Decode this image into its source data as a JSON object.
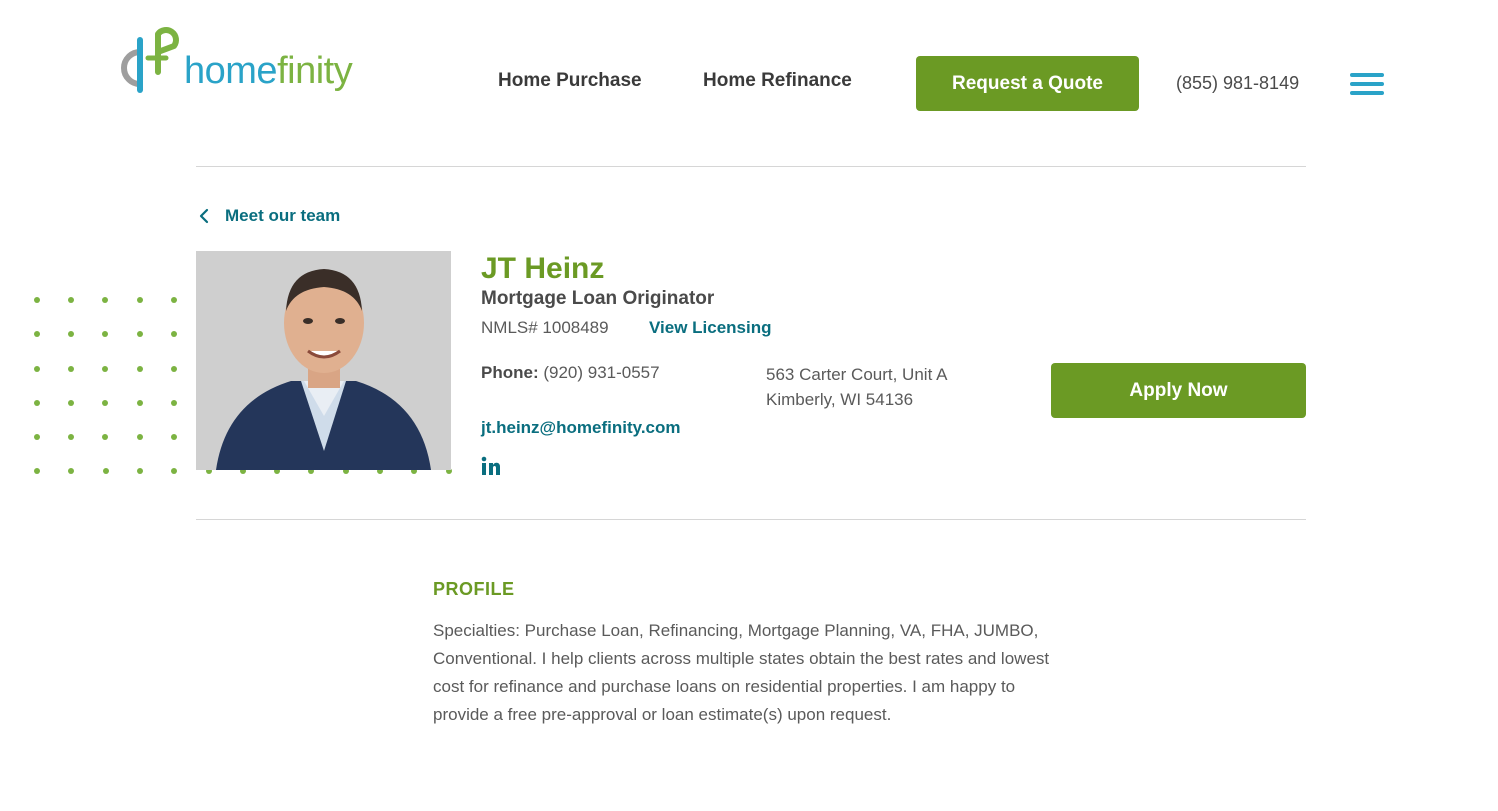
{
  "header": {
    "logo_home": "home",
    "logo_finity": "finity",
    "nav": [
      {
        "label": "Home Purchase"
      },
      {
        "label": "Home Refinance"
      }
    ],
    "cta_label": "Request a Quote",
    "phone": "(855) 981-8149",
    "menu_icon": "hamburger-icon"
  },
  "breadcrumb": {
    "icon": "chevron-left-icon",
    "label": "Meet our team"
  },
  "profile": {
    "name": "JT Heinz",
    "title": "Mortgage Loan Originator",
    "nmls": "NMLS# 1008489",
    "licensing_label": "View Licensing",
    "phone_label": "Phone:",
    "phone": "(920) 931-0557",
    "email": "jt.heinz@homefinity.com",
    "social_icon": "linkedin-icon",
    "address_line1": "563 Carter Court, Unit A",
    "address_line2": "Kimberly, WI 54136",
    "apply_label": "Apply Now"
  },
  "about": {
    "heading": "PROFILE",
    "body": "Specialties: Purchase Loan, Refinancing, Mortgage Planning, VA, FHA, JUMBO, Conventional. I help clients across multiple states obtain the best rates and lowest cost for refinance and purchase loans on residential properties. I am happy to provide a free pre-approval or loan estimate(s) upon request."
  },
  "colors": {
    "brand_green": "#6b9a24",
    "brand_teal": "#0a6e7f",
    "brand_blue": "#2aa3c8",
    "dot_green": "#7cb342"
  }
}
